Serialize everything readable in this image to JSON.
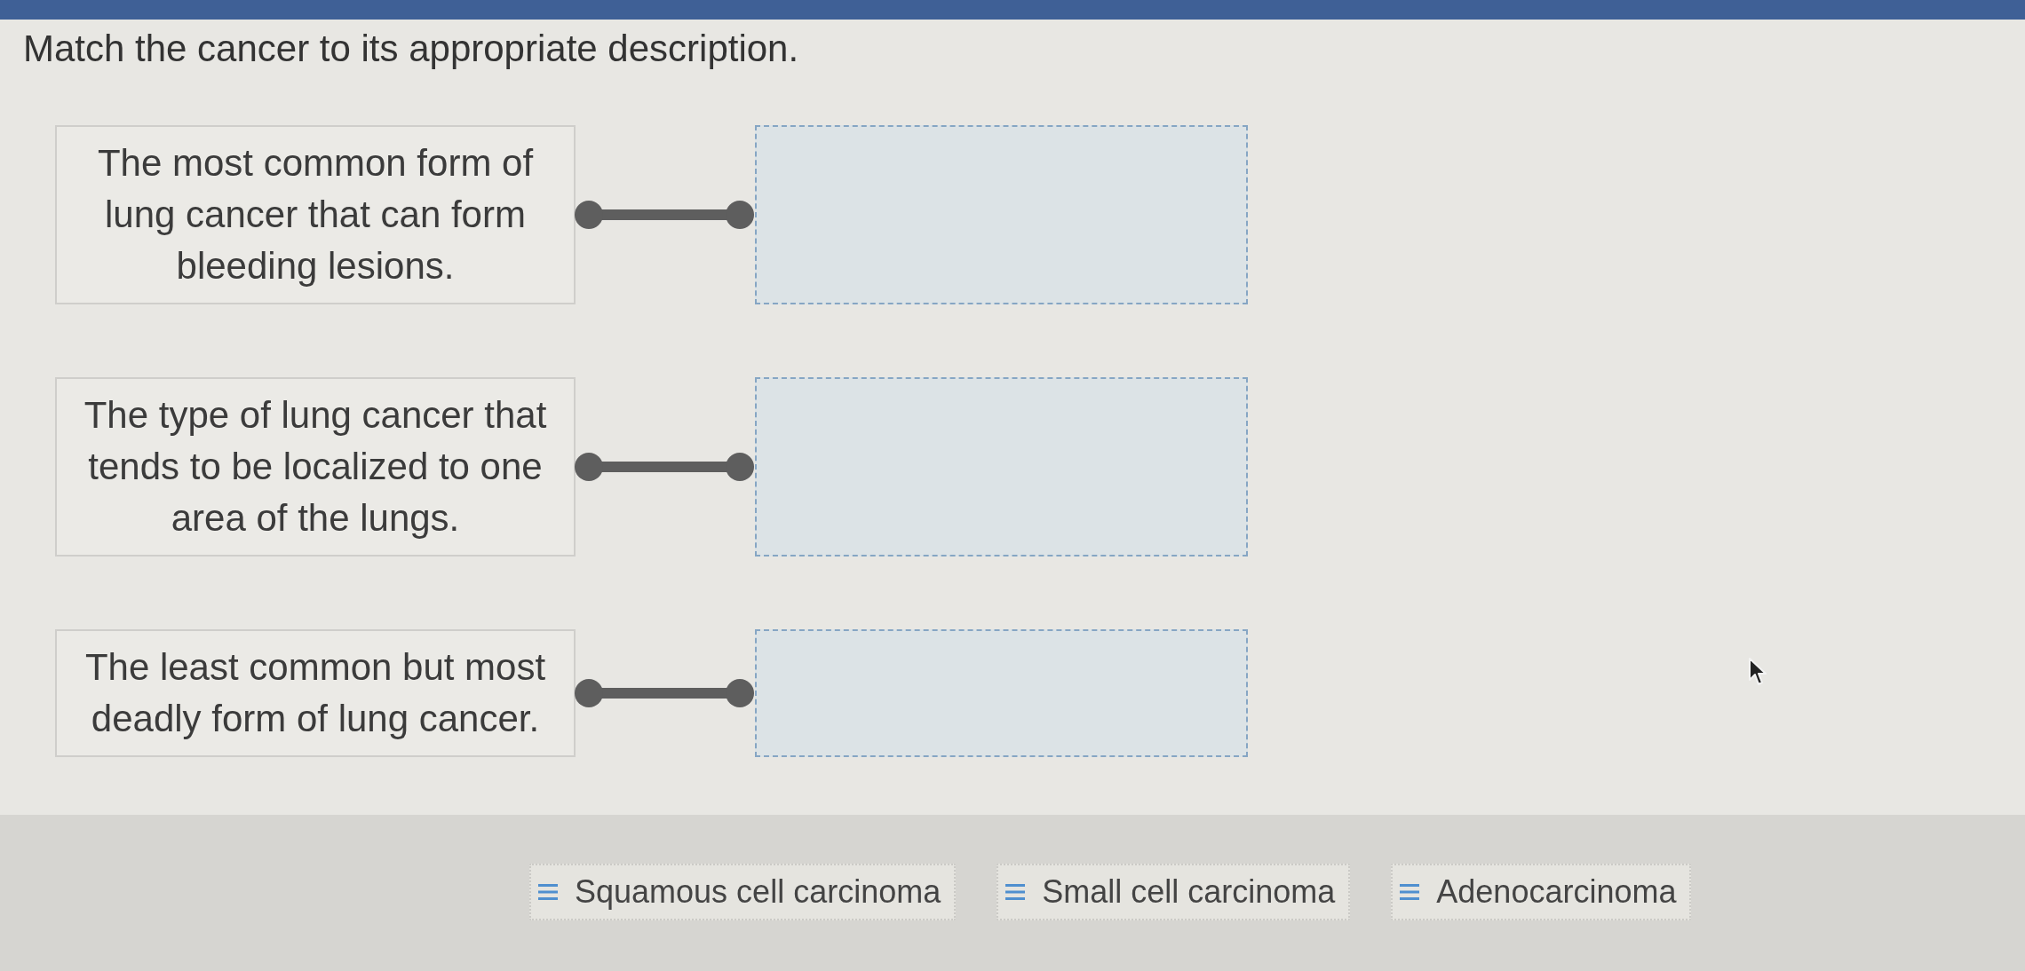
{
  "instruction": "Match the cancer to its appropriate description.",
  "pairs": [
    {
      "description": "The most common form of lung cancer that can form bleeding lesions."
    },
    {
      "description": "The type of lung cancer that tends to be localized to one area of the lungs."
    },
    {
      "description": "The least common but most deadly form of lung cancer."
    }
  ],
  "choices": [
    {
      "label": "Squamous cell carcinoma"
    },
    {
      "label": "Small cell carcinoma"
    },
    {
      "label": "Adenocarcinoma"
    }
  ]
}
